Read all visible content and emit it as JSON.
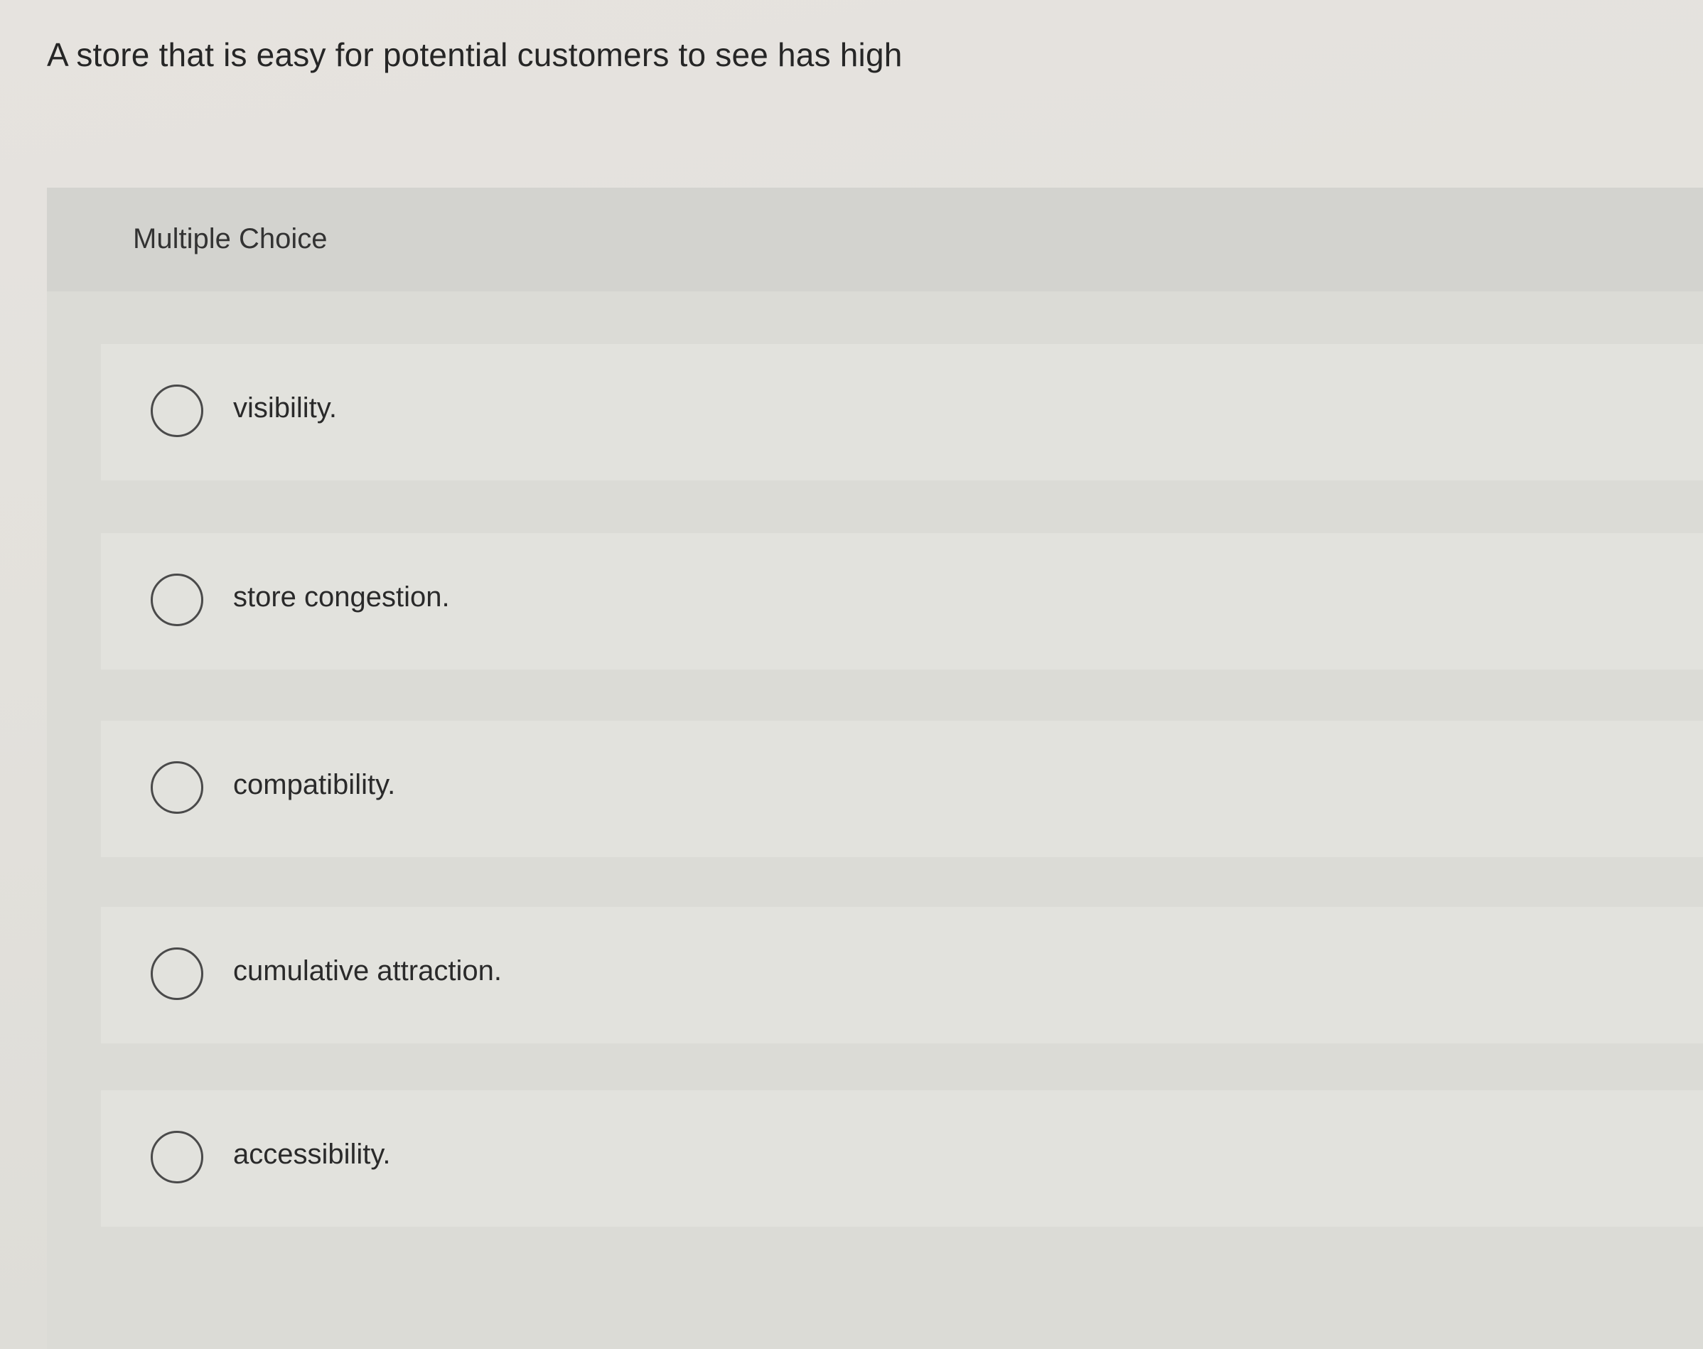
{
  "question": {
    "text": "A store that is easy for potential customers to see has high"
  },
  "panel": {
    "label": "Multiple Choice"
  },
  "choices": [
    {
      "label": "visibility.",
      "selected": false
    },
    {
      "label": "store congestion.",
      "selected": false
    },
    {
      "label": "compatibility.",
      "selected": false
    },
    {
      "label": "cumulative attraction.",
      "selected": false
    },
    {
      "label": "accessibility.",
      "selected": false
    }
  ],
  "icons": {
    "radio": "radio-unselected-icon"
  }
}
